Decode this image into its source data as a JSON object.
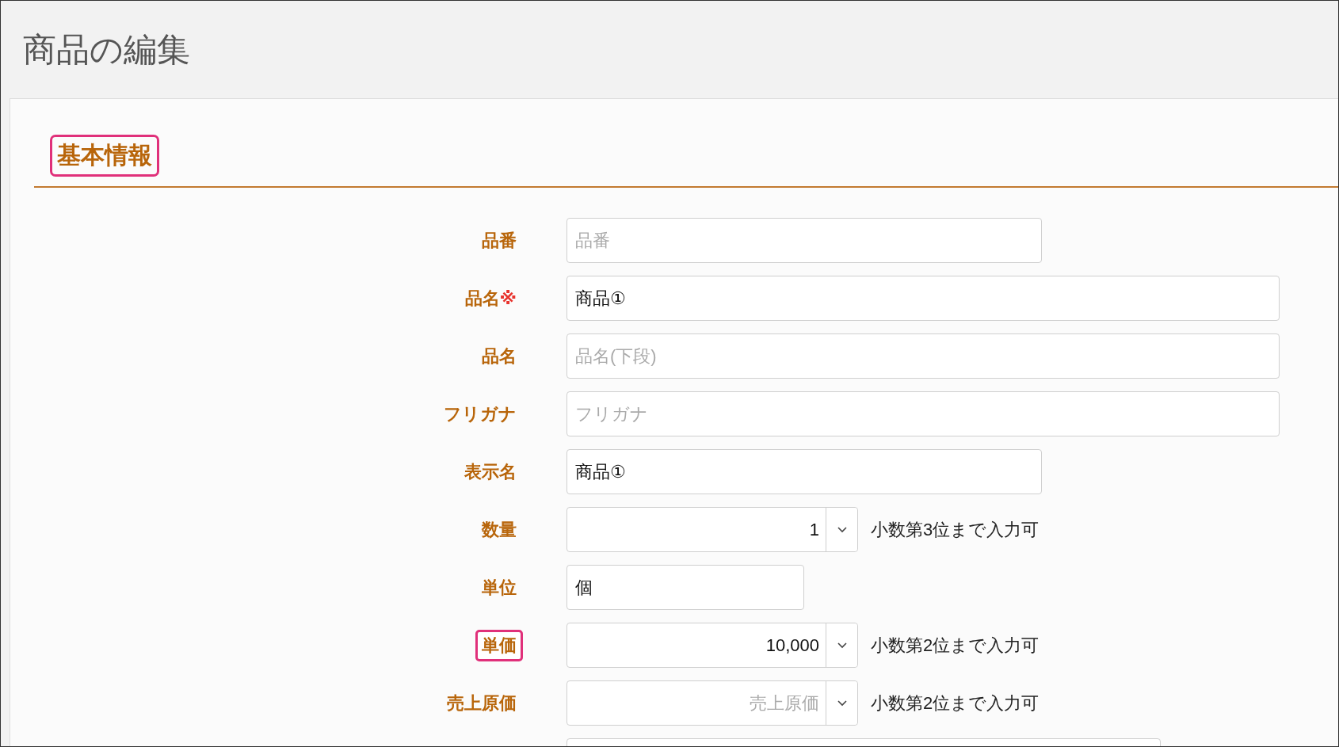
{
  "page": {
    "title": "商品の編集"
  },
  "section": {
    "title": "基本情報",
    "highlighted": true
  },
  "fields": [
    {
      "label": "品番",
      "kind": "medium",
      "placeholder": "品番",
      "highlighted": false
    },
    {
      "label": "品名",
      "required_mark": "※",
      "kind": "long",
      "value": "商品①",
      "highlighted": false
    },
    {
      "label": "品名",
      "kind": "long",
      "placeholder": "品名(下段)",
      "highlighted": false
    },
    {
      "label": "フリガナ",
      "kind": "long",
      "placeholder": "フリガナ",
      "highlighted": false
    },
    {
      "label": "表示名",
      "kind": "medium",
      "value": "商品①",
      "highlighted": false
    },
    {
      "label": "数量",
      "kind": "number",
      "value": "1",
      "note": "小数第3位まで入力可",
      "highlighted": false
    },
    {
      "label": "単位",
      "kind": "short",
      "value": "個",
      "highlighted": false
    },
    {
      "label": "単価",
      "kind": "number",
      "value": "10,000",
      "note": "小数第2位まで入力可",
      "highlighted": true
    },
    {
      "label": "売上原価",
      "kind": "number",
      "placeholder": "売上原価",
      "note": "小数第2位まで入力可",
      "highlighted": false
    },
    {
      "kind": "wide"
    }
  ]
}
